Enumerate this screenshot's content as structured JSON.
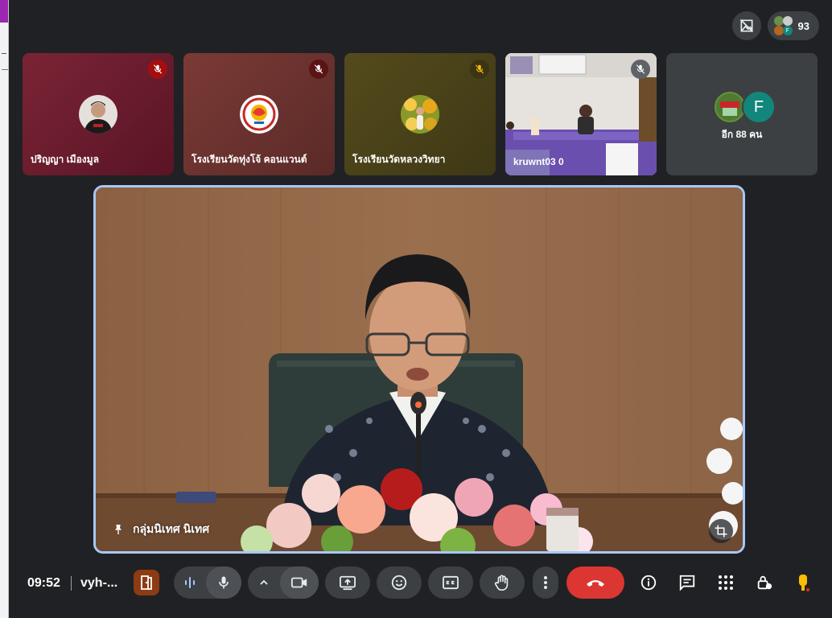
{
  "participants_count": "93",
  "tiles": [
    {
      "name": "ปริญญา เมืองมูล"
    },
    {
      "name": "โรงเรียนวัดทุ่งโจ้ คอนแวนต์"
    },
    {
      "name": "โรงเรียนวัดหลวงวิทยา"
    },
    {
      "name": "kruwnt03 0"
    }
  ],
  "more": {
    "avatar_letter": "F",
    "label": "อีก 88 คน"
  },
  "main": {
    "name": "กลุ่มนิเทศ นิเทศ"
  },
  "bottom": {
    "time": "09:52",
    "meeting_code": "vyh-..."
  },
  "colors": {
    "accent_border": "#a8c7fa",
    "end_call": "#dc3632",
    "background": "#202124",
    "avatar_f": "#12867a",
    "hand_icon": "#fbbc04"
  }
}
